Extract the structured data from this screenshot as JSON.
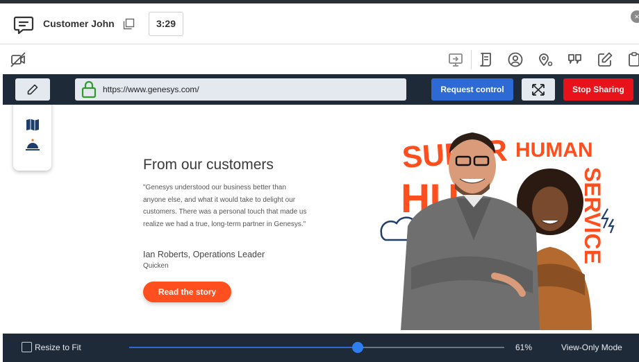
{
  "header": {
    "customer_name": "Customer John",
    "timer": "3:29",
    "close_label": "×"
  },
  "toolbar": {
    "left_icon": "no-video-icon",
    "right_icons": [
      "screen-share-icon",
      "script-icon",
      "contact-icon",
      "location-icon",
      "quote-icon",
      "edit-icon",
      "clipboard-icon"
    ]
  },
  "share_bar": {
    "url": "https://www.genesys.com/",
    "request_control_label": "Request control",
    "stop_sharing_label": "Stop Sharing"
  },
  "page": {
    "heading": "From our customers",
    "quote": "\"Genesys understood our business better than anyone else, and what it would take to delight our customers. There was a personal touch that made us realize we had a true, long-term partner in Genesys.\"",
    "author": "Ian Roberts, Operations Leader",
    "company": "Quicken",
    "cta_label": "Read the story",
    "hero_words": [
      "SUPER",
      "HUMAN",
      "SERVICE"
    ]
  },
  "footer": {
    "resize_label": "Resize to Fit",
    "zoom_value": "61%",
    "zoom_level": 0.61,
    "mode_label": "View-Only Mode"
  },
  "colors": {
    "accent_blue": "#2d6ad6",
    "stop_red": "#e8131a",
    "cta_orange": "#ff4f1f",
    "bar_dark": "#1f2a38"
  }
}
